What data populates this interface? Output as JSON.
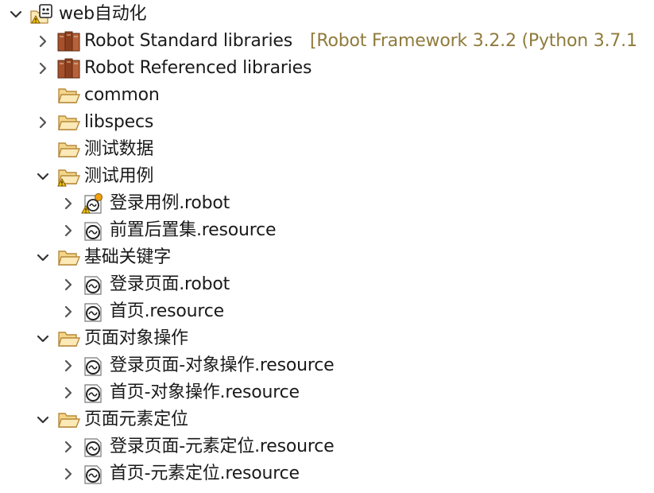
{
  "tree": {
    "project": {
      "label": "web自动化",
      "children": {
        "std_libs": {
          "label": "Robot Standard libraries",
          "decoration": "[Robot Framework 3.2.2 (Python 3.7.1"
        },
        "ref_libs": {
          "label": "Robot Referenced libraries"
        },
        "common": {
          "label": "common"
        },
        "libspecs": {
          "label": "libspecs"
        },
        "test_data": {
          "label": "测试数据"
        },
        "test_cases": {
          "label": "测试用例",
          "files": [
            {
              "label": "登录用例.robot"
            },
            {
              "label": "前置后置集.resource"
            }
          ]
        },
        "basic_keywords": {
          "label": "基础关键字",
          "files": [
            {
              "label": "登录页面.robot"
            },
            {
              "label": "首页.resource"
            }
          ]
        },
        "page_object_ops": {
          "label": "页面对象操作",
          "files": [
            {
              "label": "登录页面-对象操作.resource"
            },
            {
              "label": "首页-对象操作.resource"
            }
          ]
        },
        "page_element_locators": {
          "label": "页面元素定位",
          "files": [
            {
              "label": "登录页面-元素定位.resource"
            },
            {
              "label": "首页-元素定位.resource"
            }
          ]
        }
      }
    }
  },
  "colors": {
    "chevron": "#555555",
    "folder_fill": "#fbe9b7",
    "folder_stroke": "#b8893a",
    "library_fill": "#a6502c",
    "decoration_text": "#8f7b3c"
  }
}
